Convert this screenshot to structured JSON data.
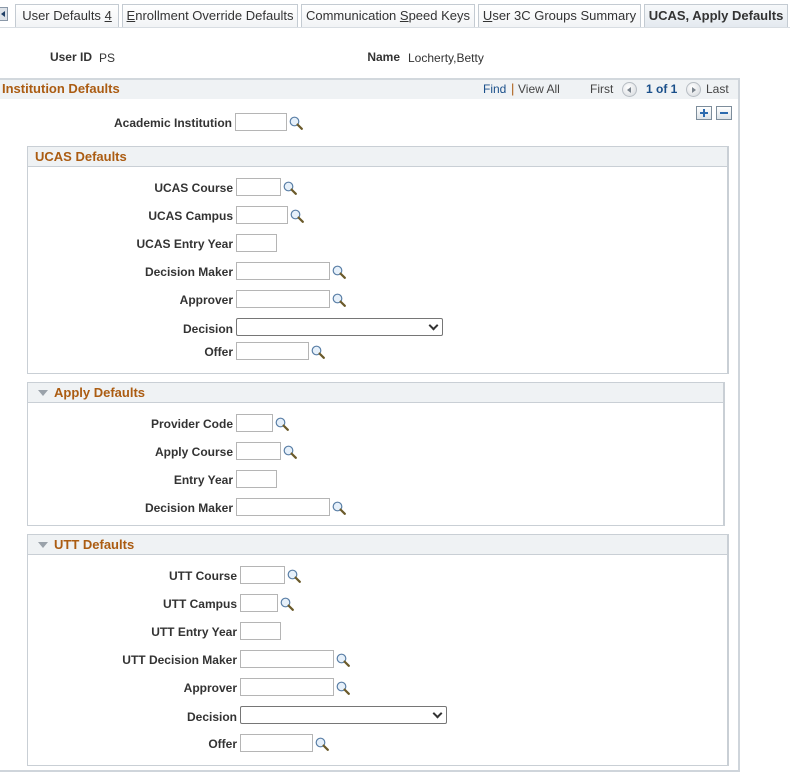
{
  "tabs": {
    "scroll_left_icon": "tab-scroll-left-icon",
    "items": [
      {
        "label": "User Defaults ",
        "accesskey": "4",
        "active": false
      },
      {
        "label_prefix": "",
        "accesskey": "E",
        "label_rest": "nrollment Override Defaults",
        "active": false
      },
      {
        "label_prefix": "Communication ",
        "accesskey": "S",
        "label_rest": "peed Keys",
        "active": false
      },
      {
        "label_prefix": "",
        "accesskey": "U",
        "label_rest": "ser 3C Groups Summary",
        "active": false
      },
      {
        "label": "UCAS, Apply Defaults",
        "active": true
      }
    ]
  },
  "header": {
    "user_id_label": "User ID",
    "user_id_value": "PS",
    "name_label": "Name",
    "name_value": "Locherty,Betty"
  },
  "institution": {
    "title": "Institution Defaults",
    "find_label": "Find",
    "separator": "|",
    "view_all_label": "View All",
    "first_label": "First",
    "page_status": "1 of 1",
    "last_label": "Last",
    "academic_institution_label": "Academic Institution",
    "academic_institution_value": ""
  },
  "ucas": {
    "title": "UCAS Defaults",
    "fields": {
      "course": {
        "label": "UCAS Course",
        "value": ""
      },
      "campus": {
        "label": "UCAS Campus",
        "value": ""
      },
      "entry_year": {
        "label": "UCAS Entry Year",
        "value": ""
      },
      "decision_maker": {
        "label": "Decision Maker",
        "value": ""
      },
      "approver": {
        "label": "Approver",
        "value": ""
      },
      "decision": {
        "label": "Decision",
        "value": ""
      },
      "offer": {
        "label": "Offer",
        "value": ""
      }
    }
  },
  "apply": {
    "title": "Apply Defaults",
    "expanded": true,
    "fields": {
      "provider_code": {
        "label": "Provider Code",
        "value": ""
      },
      "apply_course": {
        "label": "Apply Course",
        "value": ""
      },
      "entry_year": {
        "label": "Entry Year",
        "value": ""
      },
      "decision_maker": {
        "label": "Decision Maker",
        "value": ""
      }
    }
  },
  "utt": {
    "title": "UTT Defaults",
    "expanded": true,
    "fields": {
      "course": {
        "label": "UTT Course",
        "value": ""
      },
      "campus": {
        "label": "UTT Campus",
        "value": ""
      },
      "entry_year": {
        "label": "UTT Entry Year",
        "value": ""
      },
      "decision_maker": {
        "label": "UTT Decision Maker",
        "value": ""
      },
      "approver": {
        "label": "Approver",
        "value": ""
      },
      "decision": {
        "label": "Decision",
        "value": ""
      },
      "offer": {
        "label": "Offer",
        "value": ""
      }
    }
  },
  "colors": {
    "section_title": "#ab5c12",
    "link": "#1a4f8a",
    "header_bg": "#eff2f4",
    "border": "#c9cfd5"
  }
}
